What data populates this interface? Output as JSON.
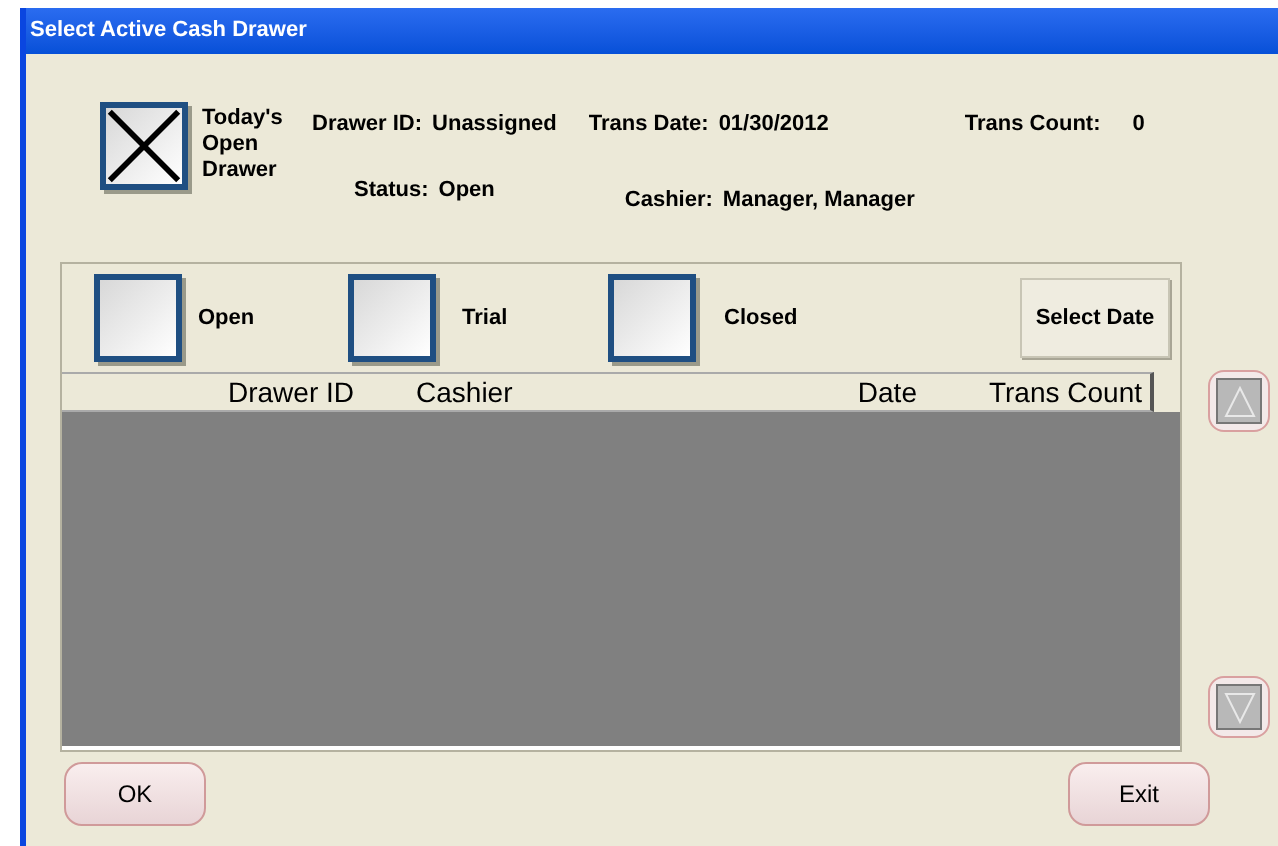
{
  "window": {
    "title": "Select Active Cash Drawer"
  },
  "todays_open_drawer": {
    "label": "Today's Open Drawer",
    "checked": true
  },
  "info": [
    {
      "label": "Drawer ID:",
      "value": "Unassigned"
    },
    {
      "label": "Trans Date:",
      "value": "01/30/2012"
    },
    {
      "label": "Trans Count:",
      "value": "0"
    },
    {
      "label": "Status:",
      "value": "Open"
    },
    {
      "label": "Cashier:",
      "value": "Manager, Manager"
    }
  ],
  "filters": [
    {
      "label": "Open",
      "checked": false
    },
    {
      "label": "Trial",
      "checked": false
    },
    {
      "label": "Closed",
      "checked": false
    }
  ],
  "select_date_button": "Select Date",
  "table": {
    "columns": [
      "Drawer ID",
      "Cashier",
      "Date",
      "Trans Count"
    ]
  },
  "buttons": {
    "ok": "OK",
    "exit": "Exit"
  }
}
